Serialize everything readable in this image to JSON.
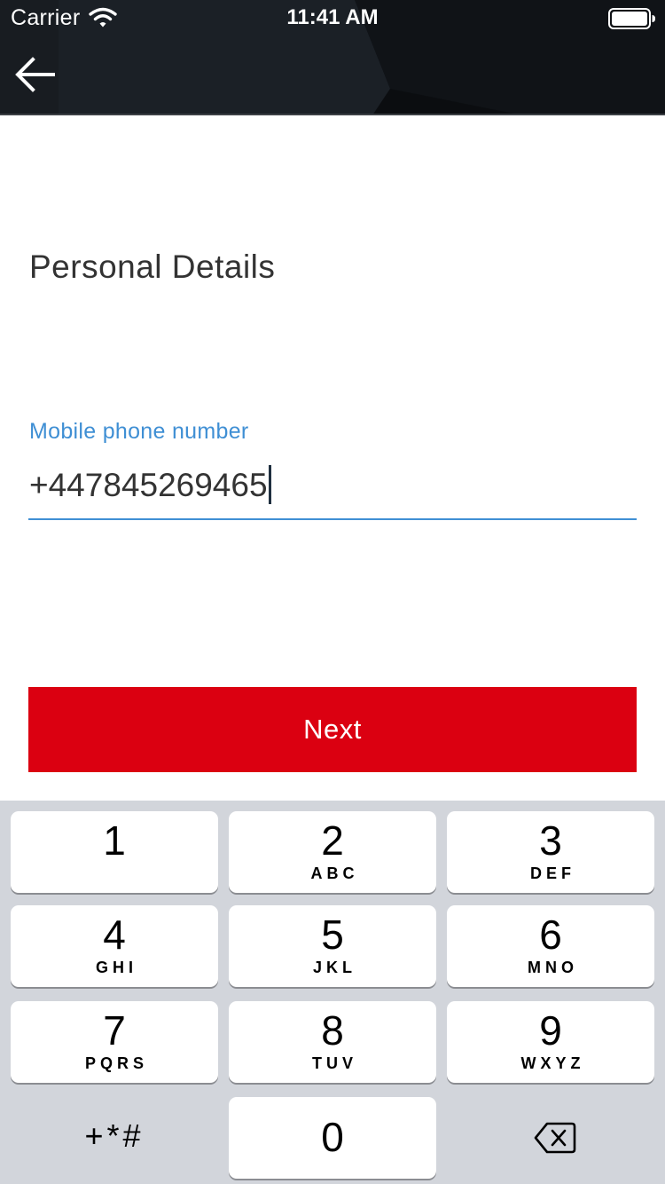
{
  "status_bar": {
    "carrier": "Carrier",
    "time": "11:41 AM",
    "wifi_icon": "wifi-icon",
    "battery_icon": "battery-full-icon"
  },
  "header": {
    "back_icon": "arrow-left-icon",
    "background_color": "#15191e"
  },
  "main": {
    "title": "Personal Details",
    "phone_field": {
      "label": "Mobile phone number",
      "value": "+447845269465",
      "focused": true
    },
    "next_button": {
      "label": "Next",
      "color": "#db0011"
    }
  },
  "keypad": {
    "keys": [
      {
        "digit": "1",
        "letters": ""
      },
      {
        "digit": "2",
        "letters": "ABC"
      },
      {
        "digit": "3",
        "letters": "DEF"
      },
      {
        "digit": "4",
        "letters": "GHI"
      },
      {
        "digit": "5",
        "letters": "JKL"
      },
      {
        "digit": "6",
        "letters": "MNO"
      },
      {
        "digit": "7",
        "letters": "PQRS"
      },
      {
        "digit": "8",
        "letters": "TUV"
      },
      {
        "digit": "9",
        "letters": "WXYZ"
      },
      {
        "digit": "0",
        "letters": ""
      }
    ],
    "symbols_label": "+*#",
    "delete_icon": "backspace-icon"
  },
  "colors": {
    "accent_blue": "#3f8fd4",
    "keypad_background": "#d2d5db"
  }
}
